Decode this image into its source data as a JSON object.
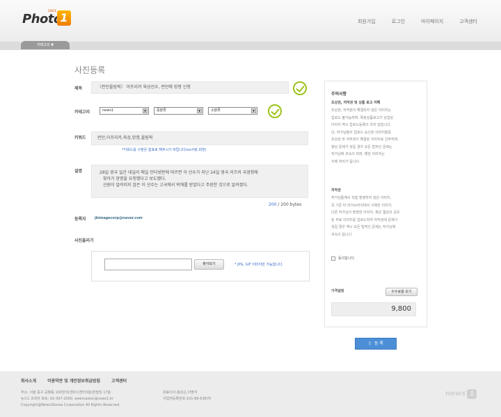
{
  "header": {
    "logo_text": "Photo",
    "logo_badge": "1",
    "logo_sup": "SINCE",
    "nav": [
      "회원가입",
      "로그인",
      "마이페이지",
      "고객센터"
    ]
  },
  "subnav": {
    "tab_label": "카테고리 ▼"
  },
  "page_title": "사진등록",
  "form": {
    "title_label": "제목",
    "title_value": "〈런던올림픽〉 아프리카 육상선수, 런던에 망명 신청",
    "category_label": "카테고리",
    "category_selects": [
      "news1",
      "중분류",
      "소분류"
    ],
    "keyword_label": "키워드",
    "keyword_value": "런던,아프리카,육상,망명,올림픽",
    "keyword_hint": "*키워드를 구분은 쉼표로 해주시기 바랍니다(ex사랑,희망)",
    "desc_label": "설명",
    "desc_lines": [
      "28일 영국 일간 데일리 메일 인터넷판에 따르면 이 선수가 지난 24일 영국 리즈의 국경청에",
      "찾아가 망명을 요청했다고 보도했다.",
      "신원이 알려지지 않은 이 선수는 고국에서 박해를 받았다고 주장한 것으로 알려졌다."
    ],
    "bytes_current": "200",
    "bytes_total": "/ 200 bytes",
    "registrant_label": "등록자",
    "registrant_email": "jbimagecorp@naver.com",
    "photo_label": "사진올리기",
    "browse_label": "찾아보기",
    "upload_hint": "* JPG, GIF 이미지만 가능합니다."
  },
  "notice": {
    "heading": "주의사항",
    "sub1": "초상권, 저작권 및 상품 로고 저해",
    "text1": [
      "초상권, 저작권이 해결되지 않은 이미지는",
      "업로드 불가능하며, 특정상품로고가 상업된",
      "이미지 역시 업로드등록이 되지 않습니다.",
      "단, 작가님들이 업로드 승인된 이미지들중",
      "초상권 및 저작권이 해결된 이미지로 간주하며,",
      "향남 문제가 생길 경우 모든 법적인 문제는",
      "작가님께 귀속이 되며, 해당 이미지는",
      "삭제 처리가 됩니다."
    ],
    "sub2": "저작권",
    "text2": [
      "작가님들께서 직접 촬영하지 않은 이미지,",
      "즉 기존 타 라이브러리에서 구매한 이미지,",
      "다른 작가님이 촬영한 이미지, 혹은 웹상의 공유",
      "된 무료 이미지를 업로드하여 저작권에 문제가",
      "생길 경우 역시 모든 법적인 문제는 작가님께",
      "귀속이 됩니다."
    ],
    "agree_label": "동의합니다.",
    "price_label": "가격설정",
    "fee_button": "수수료율 보기",
    "price_value": "9,800"
  },
  "submit_label": "등 록",
  "footer": {
    "links": [
      "회사소개",
      "이용약관 및 개인정보취급방침",
      "고객센터"
    ],
    "addr_lines": [
      "주소: 서울 중구 공평동 100번지(센트디센터3층)본빌딩 17층",
      "뉴스1 코리아 포토: 02-397-2000, webmaster@news1.kr",
      "Copyright@News1Korea Corporation All Rights Reserved."
    ],
    "ceo_lines": [
      "대표이사:홍성근,이명석",
      "사업자등록번호:101-86-63870"
    ],
    "logo_text": "news"
  }
}
